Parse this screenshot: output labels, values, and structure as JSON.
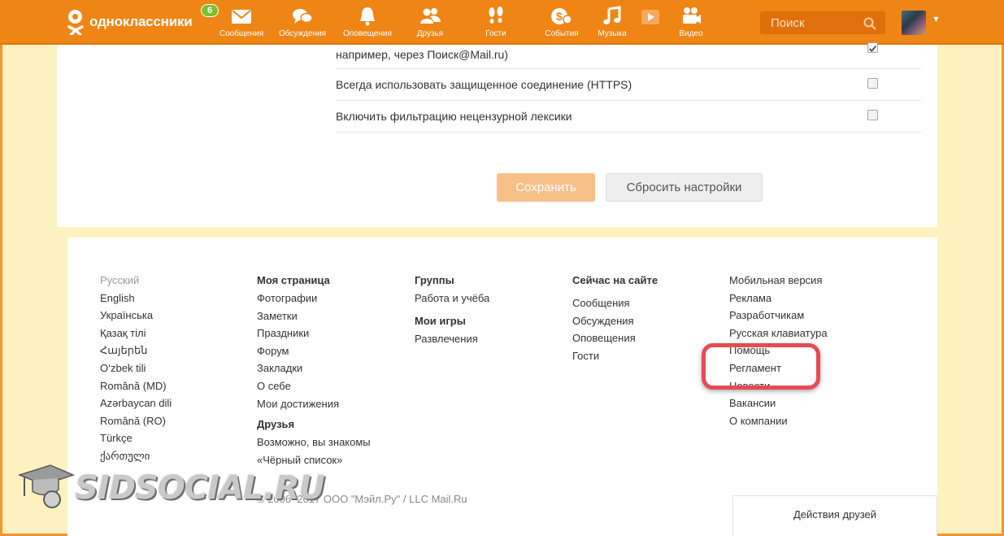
{
  "header": {
    "logo_text": "одноклассники",
    "badge_count": "6",
    "nav": [
      {
        "label": "Сообщения",
        "icon": "envelope-icon"
      },
      {
        "label": "Обсуждения",
        "icon": "chat-bubbles-icon"
      },
      {
        "label": "Оповещения",
        "icon": "bell-icon"
      },
      {
        "label": "Друзья",
        "icon": "people-icon"
      },
      {
        "label": "Гости",
        "icon": "footprints-icon"
      },
      {
        "label": "События",
        "icon": "coins-icon"
      },
      {
        "label": "Музыка",
        "icon": "music-note-icon"
      },
      {
        "label": "",
        "icon": "play-icon"
      },
      {
        "label": "Видео",
        "icon": "camera-icon"
      }
    ],
    "search_placeholder": "Поиск"
  },
  "settings": {
    "rows": [
      {
        "text": "например, через Поиск@Mail.ru)",
        "checked": true
      },
      {
        "text": "Всегда использовать защищенное соединение (HTTPS)",
        "checked": false
      },
      {
        "text": "Включить фильтрацию нецензурной лексики",
        "checked": false
      }
    ],
    "save_label": "Сохранить",
    "reset_label": "Сбросить настройки"
  },
  "footer": {
    "languages": [
      "Русский",
      "English",
      "Українська",
      "Қазақ тілі",
      "Հայերեն",
      "O‘zbek tili",
      "Română (MD)",
      "Azərbaycan dili",
      "Română (RO)",
      "Türkçe",
      "ქართული"
    ],
    "my_page": {
      "title": "Моя страница",
      "items": [
        "Фотографии",
        "Заметки",
        "Праздники",
        "Форум",
        "Закладки",
        "О себе",
        "Мои достижения"
      ]
    },
    "friends": {
      "title": "Друзья",
      "items": [
        "Возможно, вы знакомы",
        "«Чёрный список»"
      ]
    },
    "groups": {
      "title": "Группы",
      "items": [
        "Работа и учёба"
      ]
    },
    "games": {
      "title": "Мои игры",
      "items": [
        "Развлечения"
      ]
    },
    "online": {
      "title": "Сейчас на сайте",
      "items": [
        "Сообщения",
        "Обсуждения",
        "Оповещения",
        "Гости"
      ]
    },
    "misc": [
      "Мобильная версия",
      "Реклама",
      "Разработчикам",
      "Русская клавиатура",
      "Помощь",
      "Регламент",
      "Новости",
      "Вакансии",
      "О компании"
    ],
    "copyright": "© 2006–2017 ООО \"Мэйл.Ру\" / LLC Mail.Ru",
    "friends_activity": "Действия друзей"
  },
  "watermark": "SIDSOCIAL.RU",
  "colors": {
    "brand": "#ef8514",
    "highlight": "#e74a52",
    "save_button": "#f8c089",
    "page_bg": "#fdf1c0"
  }
}
